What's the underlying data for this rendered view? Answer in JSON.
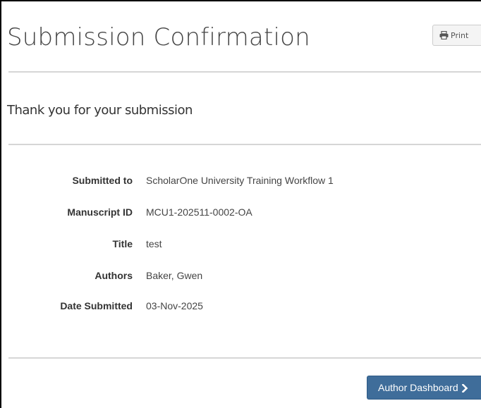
{
  "header": {
    "title": "Submission Confirmation",
    "print_label": "Print",
    "print_icon": "printer-icon"
  },
  "subtitle": "Thank you for your submission",
  "details": [
    {
      "label": "Submitted to",
      "value": "ScholarOne University Training Workflow 1"
    },
    {
      "label": "Manuscript ID",
      "value": "MCU1-202511-0002-OA"
    },
    {
      "label": "Title",
      "value": "test"
    },
    {
      "label": "Authors",
      "value": "Baker, Gwen"
    },
    {
      "label": "Date Submitted",
      "value": "03-Nov-2025"
    }
  ],
  "footer": {
    "dashboard_label": "Author Dashboard",
    "dashboard_icon": "chevron-right-icon"
  },
  "colors": {
    "primary_button": "#3f6d9a",
    "rule": "#d6d6d6"
  }
}
